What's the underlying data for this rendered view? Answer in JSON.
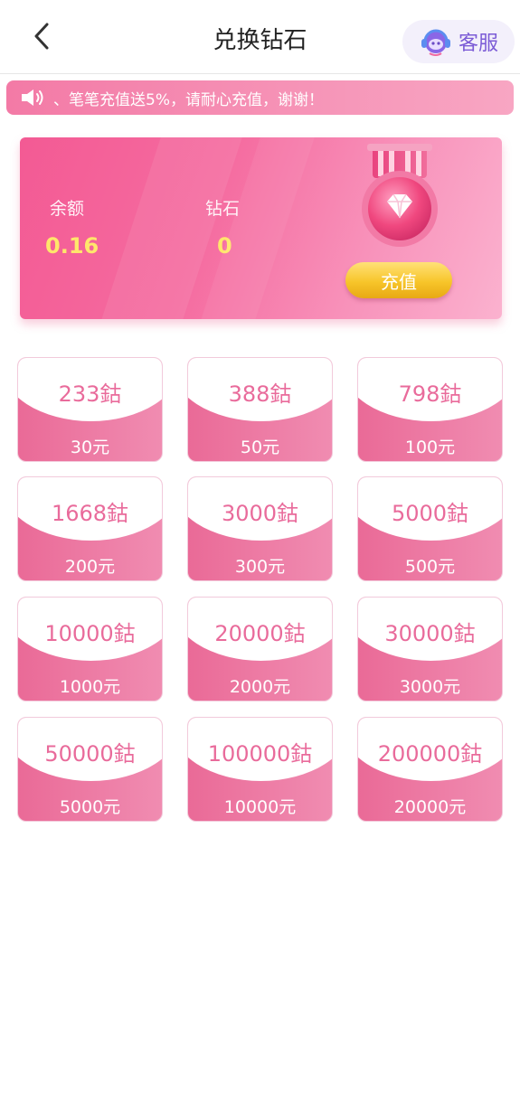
{
  "header": {
    "title": "兑换钻石",
    "service_label": "客服"
  },
  "notice": {
    "text": "、笔笔充值送5%，请耐心充值，谢谢！"
  },
  "balance_card": {
    "balance_label": "余额",
    "balance_value": "0.16",
    "diamond_label": "钻石",
    "diamond_value": "0",
    "recharge_label": "充值"
  },
  "packages": [
    {
      "diamonds": "233鈷",
      "price": "30元"
    },
    {
      "diamonds": "388鈷",
      "price": "50元"
    },
    {
      "diamonds": "798鈷",
      "price": "100元"
    },
    {
      "diamonds": "1668鈷",
      "price": "200元"
    },
    {
      "diamonds": "3000鈷",
      "price": "300元"
    },
    {
      "diamonds": "5000鈷",
      "price": "500元"
    },
    {
      "diamonds": "10000鈷",
      "price": "1000元"
    },
    {
      "diamonds": "20000鈷",
      "price": "2000元"
    },
    {
      "diamonds": "30000鈷",
      "price": "3000元"
    },
    {
      "diamonds": "50000鈷",
      "price": "5000元"
    },
    {
      "diamonds": "100000鈷",
      "price": "10000元"
    },
    {
      "diamonds": "200000鈷",
      "price": "20000元"
    }
  ],
  "icons": {
    "back": "chevron-left-icon",
    "service": "headset-icon",
    "notice": "speaker-icon",
    "medal": "diamond-medal-icon"
  },
  "colors": {
    "accent_pink": "#f35a94",
    "diamond_text": "#e96b9b",
    "value_yellow": "#ffe66b",
    "button_gold": "#f7c52a",
    "service_purple": "#7b5bd6"
  }
}
